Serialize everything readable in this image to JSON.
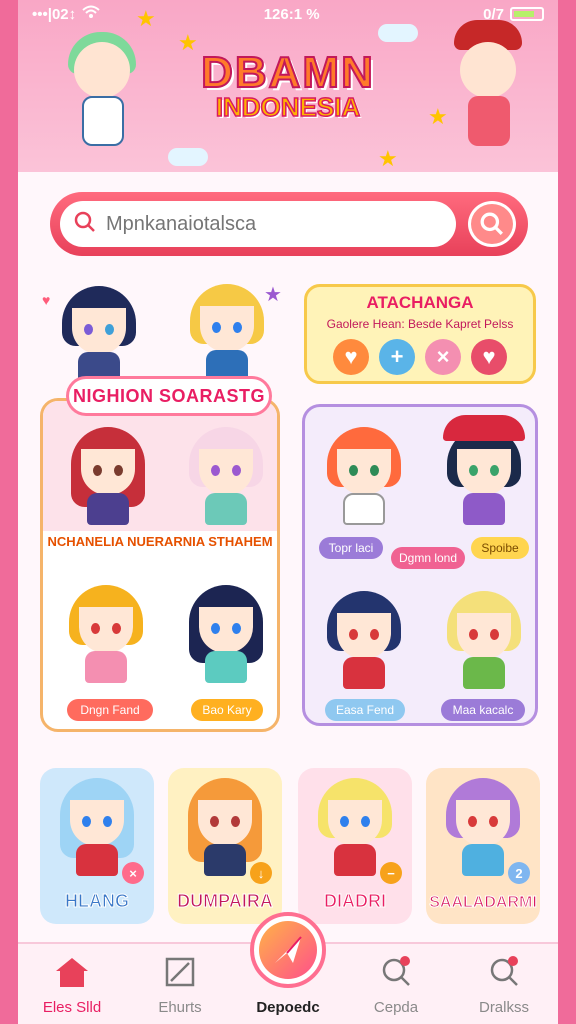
{
  "status_bar": {
    "left": "•••|02↕",
    "time": "126:1 %",
    "right": "0/7"
  },
  "header": {
    "logo_line1": "DBAMN",
    "logo_line2": "INDONESIA"
  },
  "search": {
    "placeholder": "Mpnkanaiotalsca"
  },
  "promo": {
    "title": "ATACHANGA",
    "subtitle": "Gaolere Hean: Besde Kapret Pelss",
    "actions": [
      "heart-icon",
      "plus-icon",
      "close-icon",
      "heart-icon"
    ]
  },
  "section": {
    "title": "NIGHION SOARASTG"
  },
  "left_panel": {
    "banner": "NCHANELIA NUERARNIA STHAHEM",
    "bottom_labels": [
      "Dngn Fand",
      "Bao Kary"
    ]
  },
  "right_panel": {
    "labels_mid": [
      "Topr laci",
      "Dgmn lond",
      "Spoibe"
    ],
    "labels_bottom": [
      "Easa Fend",
      "Maa kacalc"
    ]
  },
  "cards": [
    {
      "name": "HLANG",
      "badge": "×",
      "bg": "#cfe8fb",
      "badge_color": "#ff6b8b"
    },
    {
      "name": "DUMPAIRA",
      "badge": "↓",
      "bg": "#fff1c2",
      "badge_color": "#f7a21b"
    },
    {
      "name": "DIADRI",
      "badge": "−",
      "bg": "#ffe0ea",
      "badge_color": "#f7a21b"
    },
    {
      "name": "SAALADARMI",
      "badge": "2",
      "bg": "#ffe4c6",
      "badge_color": "#7fb6f0"
    }
  ],
  "tabs": [
    {
      "label": "Eles Slld",
      "icon": "home-icon"
    },
    {
      "label": "Ehurts",
      "icon": "expand-icon"
    },
    {
      "label": "Depoedc",
      "icon": "send-icon"
    },
    {
      "label": "Cepda",
      "icon": "search-icon"
    },
    {
      "label": "Dralkss",
      "icon": "search-icon"
    }
  ],
  "colors": {
    "accent": "#e91e63",
    "brand": "#ff7a2a"
  }
}
